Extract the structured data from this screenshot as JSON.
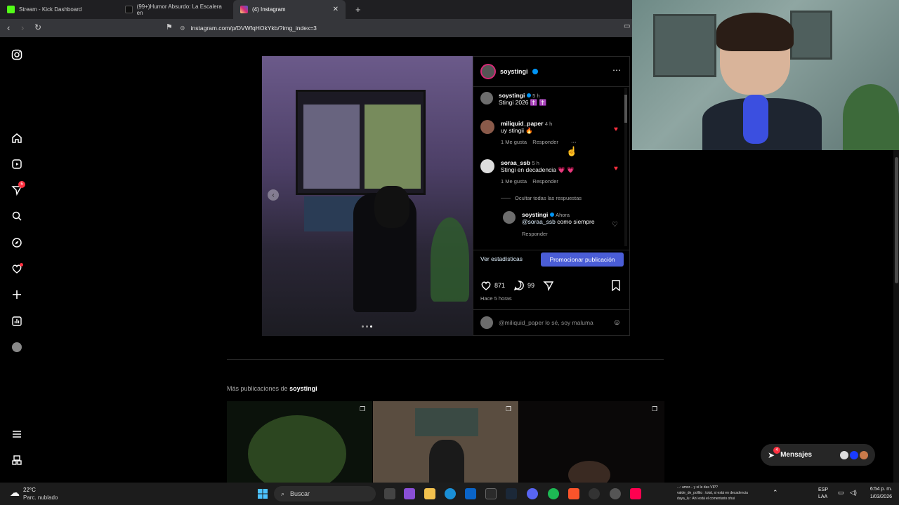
{
  "browser": {
    "tabs": [
      {
        "label": "Stream - Kick Dashboard",
        "fav_color": "#53fc18"
      },
      {
        "label": "(99+)Humor Absurdo: La Escalera en",
        "fav_color": "#111111"
      },
      {
        "label": "(4) Instagram",
        "fav_color": "#d62976"
      }
    ],
    "new_tab": "+",
    "url": "instagram.com/p/DVWfqHOkYkb/?img_index=3"
  },
  "rail": {
    "notif_badge": "5"
  },
  "post": {
    "username": "soystingi",
    "caption_user": "soystingi",
    "caption_time": "5 h",
    "caption_text": "Stingi 2026 ✝️ ✝️",
    "comments": [
      {
        "user": "miliquid_paper",
        "time": "4 h",
        "text": "uy stingii 🔥",
        "likes": "1 Me gusta",
        "reply": "Responder"
      },
      {
        "user": "soraa_ssb",
        "time": "5 h",
        "text": "Stingi en decadencia 💗 💗",
        "likes": "1 Me gusta",
        "reply": "Responder"
      }
    ],
    "hide_replies": "Ocultar todas las respuestas",
    "reply": {
      "user": "soystingi",
      "time": "Ahora",
      "mention": "@soraa_ssb",
      "text": "como siempre",
      "reply": "Responder"
    },
    "stats_label": "Ver estadísticas",
    "promote_label": "Promocionar publicación",
    "likes_count": "871",
    "comments_count": "99",
    "posted": "Hace 5 horas",
    "comment_input": "@miliquid_paper lo sé, soy maluma"
  },
  "more": {
    "prefix": "Más publicaciones de",
    "user": "soystingi"
  },
  "messages": {
    "label": "Mensajes",
    "badge": "4"
  },
  "taskbar": {
    "weather_temp": "22°C",
    "weather_desc": "Parc. nublado",
    "search": "Buscar",
    "lang": "ESP",
    "lang2": "LAA",
    "time": "6:54 p. m.",
    "date": "1/03/2026",
    "chat_lines": [
      "...: amor... y si le das VIP?",
      "valde_de_pollito : total, si está en decadencia",
      "daya_lu : Ahí está el comentario ohui"
    ]
  }
}
